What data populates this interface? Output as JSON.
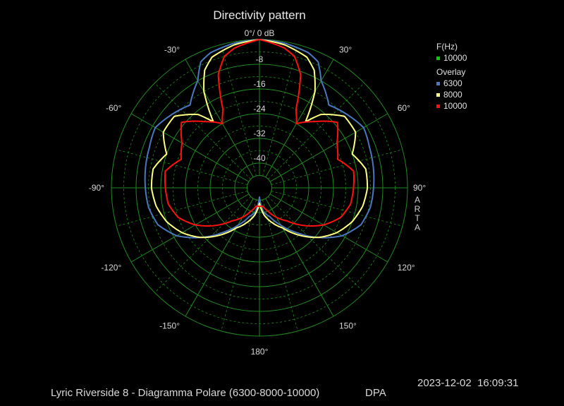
{
  "chart_data": {
    "type": "polar",
    "title": "Directivity pattern",
    "radial_unit": "dB",
    "rlim": [
      -48,
      0
    ],
    "radial_ticks": [
      "0°/ 0 dB",
      "-8",
      "-16",
      "-24",
      "-32",
      "-40"
    ],
    "angle_labels": [
      "-30°",
      "30°",
      "-60°",
      "60°",
      "-90°",
      "90°",
      "-120°",
      "120°",
      "-150°",
      "150°",
      "180°"
    ],
    "grid": true,
    "legend_position": "top-right",
    "legend": {
      "freq_header": "F(Hz)",
      "freq_entry": {
        "label": "10000",
        "color": "#00d000"
      },
      "overlay_header": "Overlay",
      "overlay_entries": [
        {
          "label": "6300",
          "color": "#4a78c0"
        },
        {
          "label": "8000",
          "color": "#ffff80"
        },
        {
          "label": "10000",
          "color": "#ff1010"
        }
      ]
    },
    "series": [
      {
        "name": "6300",
        "color": "#4a78c0",
        "angles_deg": [
          0,
          10,
          20,
          25,
          30,
          40,
          50,
          60,
          70,
          80,
          90,
          100,
          110,
          120,
          130,
          140,
          150,
          160,
          170,
          180
        ],
        "values_db": [
          0,
          -0.5,
          -1.5,
          -3,
          -8,
          -13,
          -11,
          -9,
          -10,
          -10.5,
          -11,
          -11.5,
          -13,
          -17,
          -23,
          -29,
          -34,
          -38,
          -40,
          -45
        ]
      },
      {
        "name": "8000",
        "color": "#ffff80",
        "angles_deg": [
          0,
          10,
          20,
          25,
          30,
          35,
          40,
          50,
          60,
          70,
          80,
          90,
          100,
          110,
          120,
          130,
          140,
          150,
          160,
          170,
          180
        ],
        "values_db": [
          0,
          -1,
          -3,
          -6,
          -12,
          -22,
          -17,
          -12,
          -12,
          -16,
          -13,
          -13,
          -14,
          -16,
          -19,
          -23,
          -28,
          -33,
          -36,
          -39,
          -43
        ]
      },
      {
        "name": "10000",
        "color": "#ff1010",
        "angles_deg": [
          0,
          10,
          15,
          20,
          25,
          30,
          40,
          50,
          60,
          70,
          80,
          90,
          100,
          110,
          120,
          130,
          140,
          150,
          160,
          170,
          180
        ],
        "values_db": [
          0,
          -2,
          -4,
          -9,
          -20,
          -24,
          -20,
          -15,
          -19,
          -21,
          -17,
          -17.5,
          -18,
          -20,
          -24,
          -29,
          -34,
          -37,
          -40,
          -42,
          -42
        ]
      }
    ]
  },
  "side_label": "ARTA",
  "footer_text": "Lyric Riverside 8 - Diagramma Polare (6300-8000-10000)",
  "footer_brand": "DPA",
  "timestamp": "2023-12-02  16:09:31"
}
